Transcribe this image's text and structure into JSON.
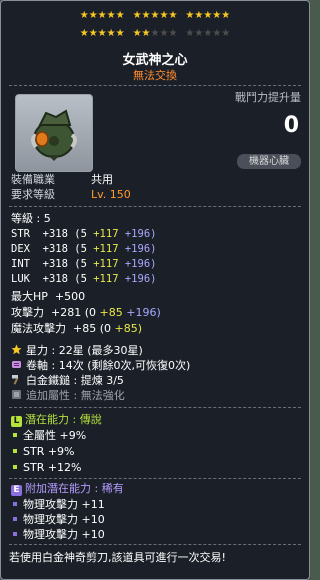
{
  "stars": {
    "filled": 22,
    "total": 30
  },
  "item": {
    "name": "女武神之心",
    "trade_status": "無法交換"
  },
  "combat_power": {
    "label": "戰鬥力提升量",
    "value": "0"
  },
  "core_button": "機器心臟",
  "equip_job": {
    "label": "裝備職業",
    "value": "共用"
  },
  "req_level": {
    "label": "要求等級",
    "value": "Lv. 150"
  },
  "level": {
    "label": "等級",
    "value": ": 5"
  },
  "stats": [
    {
      "label": "STR",
      "total": "+318",
      "base": "(5",
      "bonus": "+117",
      "scroll": "+196)"
    },
    {
      "label": "DEX",
      "total": "+318",
      "base": "(5",
      "bonus": "+117",
      "scroll": "+196)"
    },
    {
      "label": "INT",
      "total": "+318",
      "base": "(5",
      "bonus": "+117",
      "scroll": "+196)"
    },
    {
      "label": "LUK",
      "total": "+318",
      "base": "(5",
      "bonus": "+117",
      "scroll": "+196)"
    }
  ],
  "maxhp": {
    "label": "最大HP",
    "value": "+500"
  },
  "attack": {
    "label": "攻擊力",
    "total": "+281",
    "base": "(0",
    "bonus": "+85",
    "scroll": "+196)"
  },
  "magic": {
    "label": "魔法攻擊力",
    "total": "+85",
    "base": "(0",
    "bonus": "+85)"
  },
  "star_force": {
    "label": "星力",
    "value": ": 22星 (最多30星)"
  },
  "scroll": {
    "label": "卷軸",
    "value": ": 14次 (剩餘0次,可恢復0次)"
  },
  "hammer": {
    "label": "白金鐵鎚",
    "value": ": 提煉 3/5"
  },
  "extra": {
    "label": "追加屬性",
    "value": ": 無法強化"
  },
  "potential": {
    "badge": "L",
    "title": "潛在能力",
    "grade": ": 傳說",
    "lines": [
      "全屬性 +9%",
      "STR +9%",
      "STR +12%"
    ]
  },
  "additional": {
    "badge": "E",
    "title": "附加潛在能力",
    "grade": ": 稀有",
    "lines": [
      "物理攻擊力 +11",
      "物理攻擊力 +10",
      "物理攻擊力 +10"
    ]
  },
  "footer": "若使用白金神奇剪刀,該道具可進行一次交易!",
  "colors": {
    "star_on": "#f6c824",
    "star_off": "#4d4d4d",
    "potential": "#b6e23c",
    "additional": "#8a6fe0",
    "trade": "#ff8b2b"
  }
}
